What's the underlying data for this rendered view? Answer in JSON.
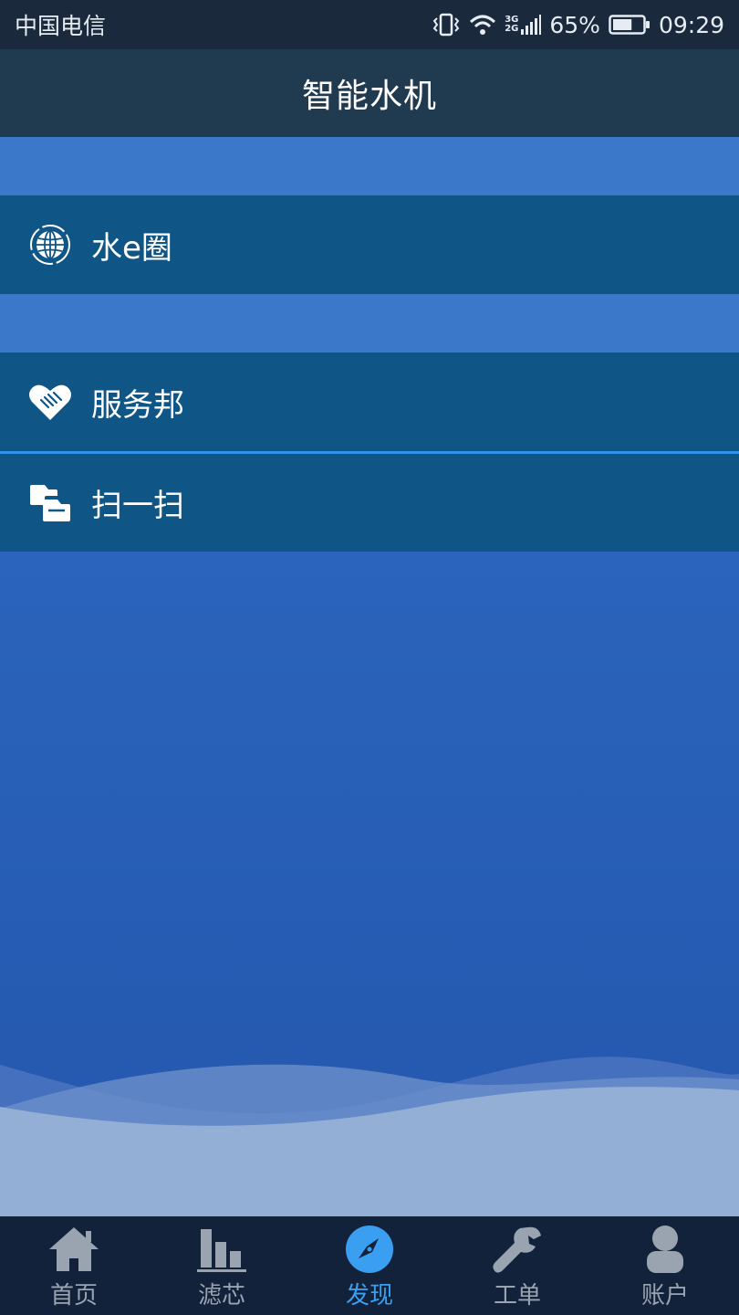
{
  "status_bar": {
    "carrier": "中国电信",
    "network_top": "3G",
    "network_bottom": "2G",
    "battery_percent": "65%",
    "battery_level": 0.65,
    "time": "09:29"
  },
  "header": {
    "title": "智能水机"
  },
  "menu": [
    {
      "label": "水e圈",
      "icon": "globe-icon"
    },
    {
      "label": "服务邦",
      "icon": "handshake-heart-icon"
    },
    {
      "label": "扫一扫",
      "icon": "scan-icon"
    }
  ],
  "tabbar": {
    "active": "发现",
    "active_color": "#3a9ff0",
    "inactive_color": "#9aa4b1",
    "items": [
      {
        "label": "首页",
        "icon": "home-icon"
      },
      {
        "label": "滤芯",
        "icon": "bar-chart-icon"
      },
      {
        "label": "发现",
        "icon": "compass-icon"
      },
      {
        "label": "工单",
        "icon": "wrench-icon"
      },
      {
        "label": "账户",
        "icon": "user-icon"
      }
    ]
  }
}
